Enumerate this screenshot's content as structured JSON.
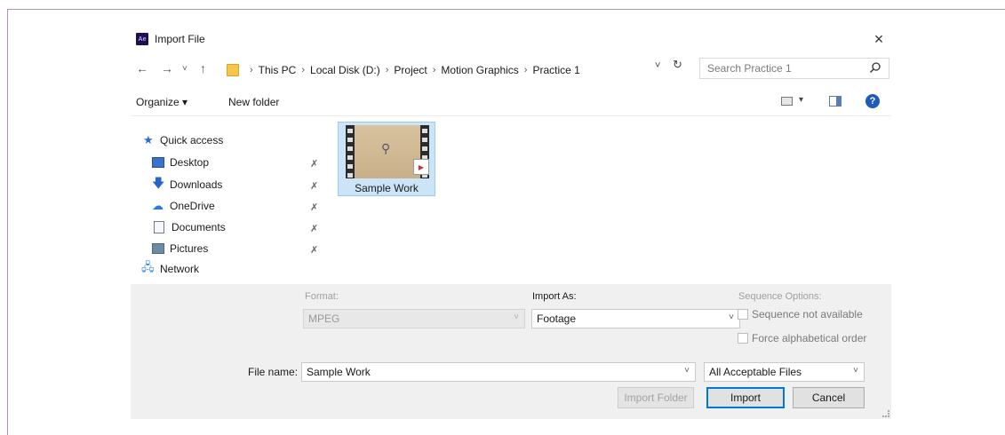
{
  "window": {
    "app_badge": "Ae",
    "title": "Import File",
    "close": "×"
  },
  "nav": {
    "back": "←",
    "forward": "→",
    "recent": "˅",
    "up": "↑",
    "breadcrumbs": [
      "This PC",
      "Local Disk (D:)",
      "Project",
      "Motion Graphics",
      "Practice 1"
    ],
    "separator": "›",
    "dropdown": "˅",
    "refresh": "↻",
    "search_placeholder": "Search Practice 1"
  },
  "toolbar": {
    "organize": "Organize ▾",
    "new_folder": "New folder",
    "help": "?",
    "view_drop": "▾"
  },
  "sidebar": {
    "quick_access": "Quick access",
    "items": [
      {
        "label": "Desktop",
        "pinned": true
      },
      {
        "label": "Downloads",
        "pinned": true
      },
      {
        "label": "OneDrive",
        "pinned": true
      },
      {
        "label": "Documents",
        "pinned": true
      },
      {
        "label": "Pictures",
        "pinned": true
      }
    ],
    "network": "Network"
  },
  "files": [
    {
      "name": "Sample Work",
      "selected": true
    }
  ],
  "options": {
    "format_label": "Format:",
    "format_value": "MPEG",
    "import_as_label": "Import As:",
    "import_as_value": "Footage",
    "sequence_label": "Sequence Options:",
    "sequence_checkbox": "Sequence not available",
    "alpha_checkbox": "Force alphabetical order"
  },
  "footer": {
    "file_name_label": "File name:",
    "file_name_value": "Sample Work",
    "file_type": "All Acceptable Files",
    "import_folder": "Import Folder",
    "import": "Import",
    "cancel": "Cancel"
  }
}
